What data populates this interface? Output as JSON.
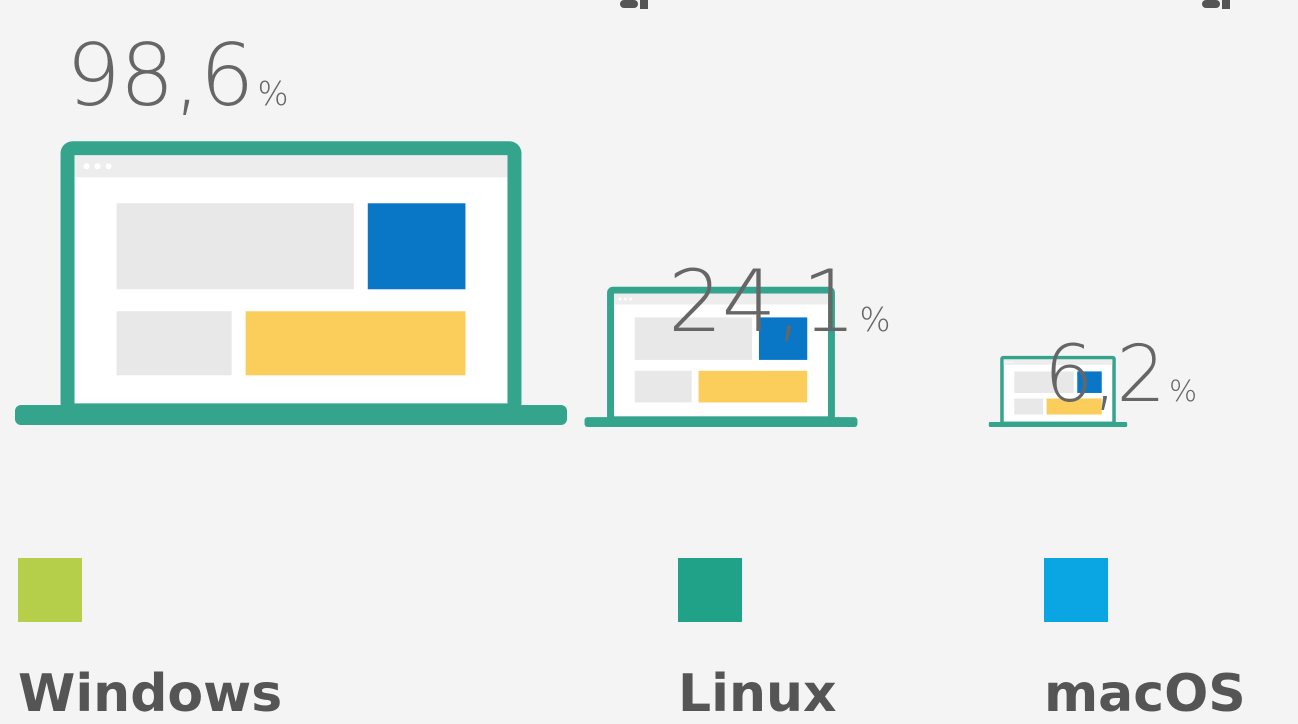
{
  "chart_data": {
    "type": "bar",
    "categories": [
      "Windows",
      "Linux",
      "macOS"
    ],
    "values": [
      98.6,
      24.1,
      6.2
    ],
    "value_labels": [
      "98,6",
      "24,1",
      "6,2"
    ],
    "unit": "%",
    "series_colors": [
      "#b5cf4b",
      "#1fa287",
      "#0aa6e4"
    ],
    "device_colors": {
      "frame": "#34a48c",
      "screen": "#ffffff",
      "topbar": "#ededed",
      "block_gray": "#e8e8e8",
      "block_blue": "#0a77c6",
      "block_yellow": "#fbcd5b"
    }
  }
}
